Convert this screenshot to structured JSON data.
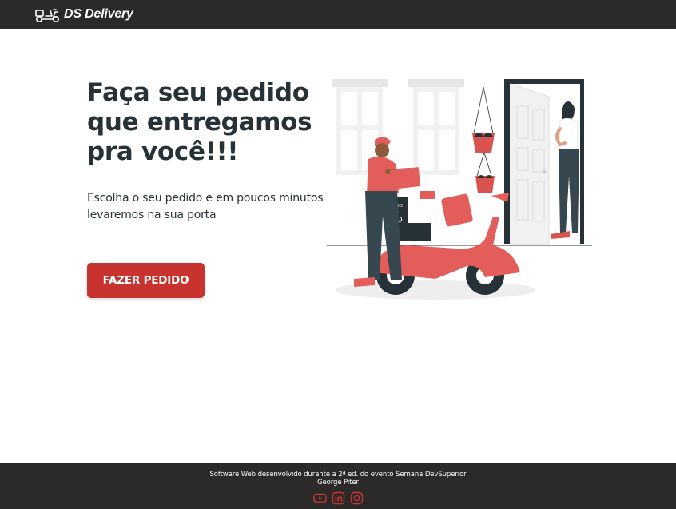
{
  "navbar": {
    "logo_icon": "scooter-icon",
    "brand": "DS Delivery"
  },
  "hero": {
    "title": "Faça seu pedido que entregamos pra você!!!",
    "subtitle": "Escolha o seu pedido e em poucos minutos levaremos na sua porta",
    "cta_label": "FAZER PEDIDO",
    "illustration_box_text_top": "FOOD",
    "illustration_box_text_mid": "TO",
    "illustration_box_text_bottom": "GO"
  },
  "footer": {
    "line1": "Software Web desenvolvido durante a 2ª ed. do evento Semana DevSuperior",
    "line2": "George Piter",
    "social_icons": [
      "youtube-icon",
      "linkedin-icon",
      "instagram-icon"
    ]
  },
  "colors": {
    "navbar_bg": "#2b2a29",
    "accent": "#c8332f",
    "text_dark": "#263238"
  }
}
